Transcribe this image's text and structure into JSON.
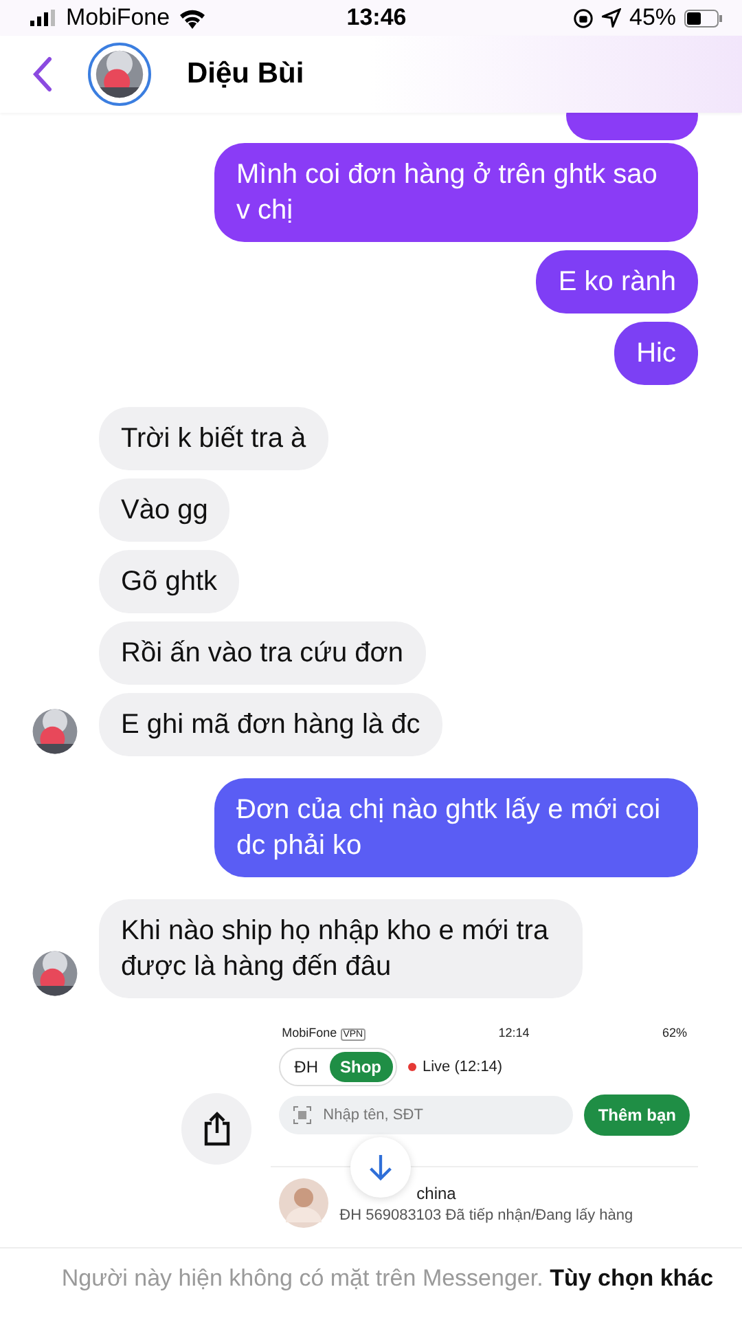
{
  "status_bar": {
    "carrier": "MobiFone",
    "time": "13:46",
    "battery": "45%"
  },
  "header": {
    "contact_name": "Diệu Bùi"
  },
  "messages": [
    {
      "kind": "sent",
      "text": "Mình coi đơn hàng ở trên ghtk sao v chị",
      "color": "#8a3cf6"
    },
    {
      "kind": "sent",
      "text": "E ko rành",
      "color": "#7f3ef5"
    },
    {
      "kind": "sent",
      "text": "Hic",
      "color": "#7c40f4"
    },
    {
      "kind": "received",
      "text": "Trời k biết tra à",
      "avatar": false
    },
    {
      "kind": "received",
      "text": "Vào gg",
      "avatar": false
    },
    {
      "kind": "received",
      "text": "Gõ ghtk",
      "avatar": false
    },
    {
      "kind": "received",
      "text": "Rồi ấn vào tra cứu đơn",
      "avatar": false
    },
    {
      "kind": "received",
      "text": "E ghi mã đơn hàng là đc",
      "avatar": true
    },
    {
      "kind": "sent",
      "text": "Đơn của chị nào ghtk lấy e mới coi dc phải ko",
      "color": "#5a5df4"
    },
    {
      "kind": "received",
      "text": "Khi nào ship họ nhập kho e mới tra được là hàng đến đâu",
      "avatar": true
    }
  ],
  "attachment": {
    "status_bar": {
      "carrier": "MobiFone",
      "vpn": "VPN",
      "time": "12:14",
      "battery": "62%"
    },
    "tabs": [
      {
        "label": "ĐH",
        "selected": false
      },
      {
        "label": "Shop",
        "selected": true
      }
    ],
    "live": "Live (12:14)",
    "search": {
      "placeholder": "Nhập tên, SĐT"
    },
    "add_button": "Thêm bạn",
    "contact": {
      "name": "china",
      "detail": "ĐH 569083103 Đã tiếp nhận/Đang lấy hàng"
    }
  },
  "footer": {
    "notice": "Người này hiện không có mặt trên Messenger.",
    "link": "Tùy chọn khác"
  }
}
